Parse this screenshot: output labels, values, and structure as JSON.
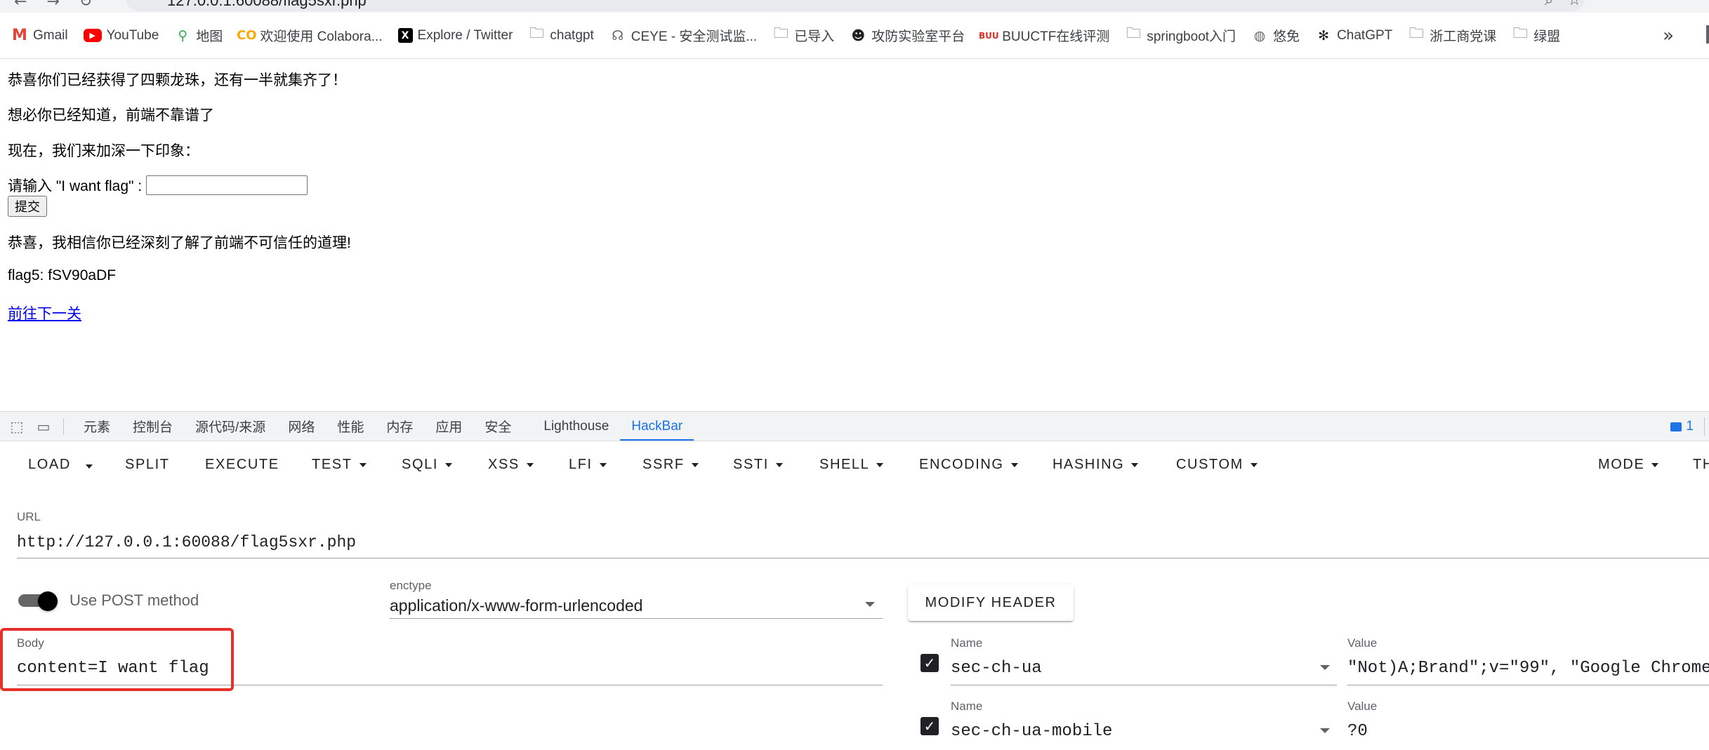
{
  "browser": {
    "url": "127.0.0.1:60088/flag5sxr.php",
    "bookmarks": [
      {
        "label": "Gmail",
        "icon": "gmail-icon"
      },
      {
        "label": "YouTube",
        "icon": "youtube-icon"
      },
      {
        "label": "地图",
        "icon": "maps-icon"
      },
      {
        "label": "欢迎使用 Colabora...",
        "icon": "colab-icon"
      },
      {
        "label": "Explore / Twitter",
        "icon": "x-icon"
      },
      {
        "label": "chatgpt",
        "icon": "folder-icon"
      },
      {
        "label": "CEYE - 安全测试监...",
        "icon": "ceye-icon"
      },
      {
        "label": "已导入",
        "icon": "folder-icon"
      },
      {
        "label": "攻防实验室平台",
        "icon": "hacker-icon"
      },
      {
        "label": "BUUCTF在线评测",
        "icon": "buuctf-icon"
      },
      {
        "label": "springboot入门",
        "icon": "folder-icon"
      },
      {
        "label": "悠免",
        "icon": "globe-icon"
      },
      {
        "label": "ChatGPT",
        "icon": "openai-icon"
      },
      {
        "label": "浙工商党课",
        "icon": "folder-icon"
      },
      {
        "label": "绿盟",
        "icon": "folder-icon"
      }
    ],
    "more": "»"
  },
  "page": {
    "line1": "恭喜你们已经获得了四颗龙珠，还有一半就集齐了！",
    "line2": "想必你已经知道，前端不靠谱了",
    "line3": "现在，我们来加深一下印象：",
    "prompt": "请输入 \"I want flag\" :",
    "input_value": "",
    "submit": "提交",
    "line5": "恭喜，我相信你已经深刻了解了前端不可信任的道理!",
    "flag": "flag5: fSV90aDF",
    "next_link": "前往下一关"
  },
  "devtools": {
    "tabs": [
      "元素",
      "控制台",
      "源代码/来源",
      "网络",
      "性能",
      "内存",
      "应用",
      "安全",
      "Lighthouse",
      "HackBar"
    ],
    "active_tab": "HackBar",
    "issues_count": "1"
  },
  "hackbar": {
    "toolbar": [
      "LOAD",
      "SPLIT",
      "EXECUTE",
      "TEST",
      "SQLI",
      "XSS",
      "LFI",
      "SSRF",
      "SSTI",
      "SHELL",
      "ENCODING",
      "HASHING",
      "CUSTOM"
    ],
    "mode": "MODE",
    "theme": "TH",
    "url_label": "URL",
    "url": "http://127.0.0.1:60088/flag5sxr.php",
    "post_label": "Use POST method",
    "post_enabled": true,
    "enctype_label": "enctype",
    "enctype": "application/x-www-form-urlencoded",
    "modify_header": "MODIFY HEADER",
    "body_label": "Body",
    "body": "content=I want flag",
    "highlight_color": "#e8302a",
    "headers": [
      {
        "enabled": true,
        "name_label": "Name",
        "name": "sec-ch-ua",
        "value_label": "Value",
        "value": "\"Not)A;Brand\";v=\"99\", \"Google Chrome"
      },
      {
        "enabled": true,
        "name_label": "Name",
        "name": "sec-ch-ua-mobile",
        "value_label": "Value",
        "value": "?0"
      }
    ]
  }
}
